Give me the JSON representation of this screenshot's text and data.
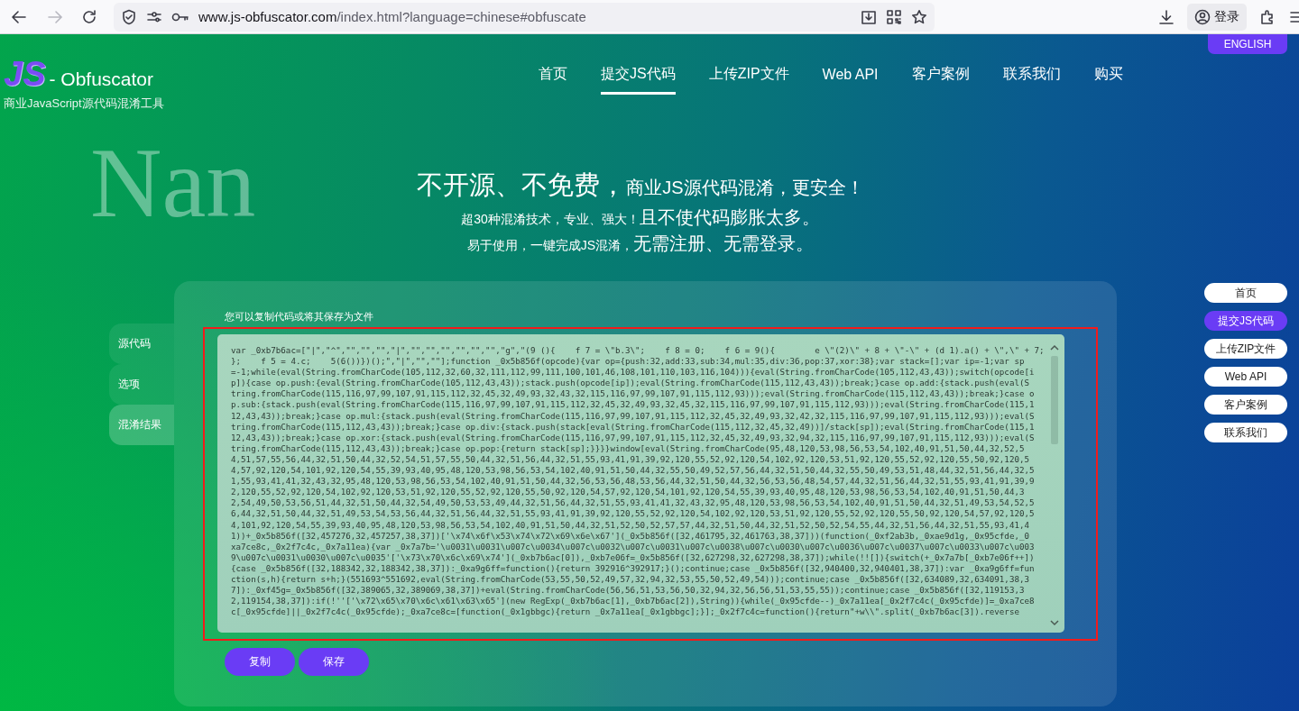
{
  "browser": {
    "forward_disabled": true,
    "url_host": "www.js-obfuscator.com",
    "url_path": "/index.html?language=chinese#obfuscate",
    "sign_in": "登录"
  },
  "header": {
    "logo_mark": "JS",
    "logo_name": "- Obfuscator",
    "tagline": "商业JavaScript源代码混淆工具",
    "language_button": "ENGLISH",
    "nav": [
      {
        "label": "首页",
        "selected": false
      },
      {
        "label": "提交JS代码",
        "selected": true
      },
      {
        "label": "上传ZIP文件",
        "selected": false
      },
      {
        "label": "Web API",
        "selected": false
      },
      {
        "label": "客户案例",
        "selected": false
      },
      {
        "label": "联系我们",
        "selected": false
      },
      {
        "label": "购买",
        "selected": false
      }
    ]
  },
  "backdrop_text": "Nan",
  "hero": [
    [
      {
        "text": "不开源、不免费，",
        "kind": "large"
      },
      {
        "text": "商业JS源代码混淆，更安全！",
        "kind": "medium"
      }
    ],
    [
      {
        "text": "超30种混淆技术，专业、强大！",
        "kind": "small"
      },
      {
        "text": "且不使代码膨胀太多。",
        "kind": "medium"
      }
    ],
    [
      {
        "text": "易于使用，一键完成JS混淆，",
        "kind": "small"
      },
      {
        "text": "无需注册、无需登录。",
        "kind": "medium"
      }
    ]
  ],
  "panel": {
    "tabs": [
      {
        "label": "源代码",
        "selected": false
      },
      {
        "label": "选项",
        "selected": false
      },
      {
        "label": "混淆结果",
        "selected": true
      }
    ],
    "hint": "您可以复制代码或将其保存为文件",
    "highlighted": true,
    "code_lines": [
      "var _0xb7b6ac=[\"|\",\"^\",\"\",\"\",\"\",\"|\",\"\",\"\",\"\",\"\",\"\",\"\",\"g\",\"(9 (){    f 7 = \\\"b.3\\\";    f 8 = 0;    f 6 = 9(){        e \\\"(2)\\\" + 8 + \\\"-\\\" + (d 1).a() + \\\",\\\" + 7;",
      "};    f 5 = 4.c;    5(6())})();\",\"|\",\"\",\"\"];function _0x5b856f(opcode){var op={push:32,add:33,sub:34,mul:35,div:36,pop:37,xor:38};var stack=[];var ip=-1;var sp",
      "=-1;while(eval(String.fromCharCode(105,112,32,60,32,111,112,99,111,100,101,46,108,101,110,103,116,104))){eval(String.fromCharCode(105,112,43,43));switch(opcode[i",
      "p]){case op.push:{eval(String.fromCharCode(105,112,43,43));stack.push(opcode[ip]);eval(String.fromCharCode(115,112,43,43));break;}case op.add:{stack.push(eval(S",
      "tring.fromCharCode(115,116,97,99,107,91,115,112,32,45,32,49,93,32,43,32,115,116,97,99,107,91,115,112,93)));eval(String.fromCharCode(115,112,43,43));break;}case o",
      "p.sub:{stack.push(eval(String.fromCharCode(115,116,97,99,107,91,115,112,32,45,32,49,93,32,45,32,115,116,97,99,107,91,115,112,93)));eval(String.fromCharCode(115,1",
      "12,43,43));break;}case op.mul:{stack.push(eval(String.fromCharCode(115,116,97,99,107,91,115,112,32,45,32,49,93,32,42,32,115,116,97,99,107,91,115,112,93)));eval(S",
      "tring.fromCharCode(115,112,43,43));break;}case op.div:{stack.push(stack[eval(String.fromCharCode(115,112,32,45,32,49))]/stack[sp]);eval(String.fromCharCode(115,1",
      "12,43,43));break;}case op.xor:{stack.push(eval(String.fromCharCode(115,116,97,99,107,91,115,112,32,45,32,49,93,32,94,32,115,116,97,99,107,91,115,112,93)));eval(S",
      "tring.fromCharCode(115,112,43,43));break;}case op.pop:{return stack[sp];}}}}window[eval(String.fromCharCode(95,48,120,53,98,56,53,54,102,40,91,51,50,44,32,52,5",
      "4,51,57,55,56,44,32,51,50,44,32,52,54,51,57,55,50,44,32,51,56,44,32,51,55,93,41,91,39,92,120,55,52,92,120,54,102,92,120,53,51,92,120,55,52,92,120,55,50,92,120,5",
      "4,57,92,120,54,101,92,120,54,55,39,93,40,95,48,120,53,98,56,53,54,102,40,91,51,50,44,32,55,50,49,52,57,56,44,32,51,50,44,32,55,50,49,53,51,48,44,32,51,56,44,32,5",
      "1,55,93,41,41,32,43,32,95,48,120,53,98,56,53,54,102,40,91,51,50,44,32,56,53,56,48,53,56,44,32,51,50,44,32,56,53,56,48,54,57,44,32,51,56,44,32,51,55,93,41,91,39,9",
      "2,120,55,52,92,120,54,102,92,120,53,51,92,120,55,52,92,120,55,50,92,120,54,57,92,120,54,101,92,120,54,55,39,93,40,95,48,120,53,98,56,53,54,102,40,91,51,50,44,3",
      "2,54,49,50,53,56,51,44,32,51,50,44,32,54,49,50,53,53,49,44,32,51,56,44,32,51,55,93,41,41,32,43,32,95,48,120,53,98,56,53,54,102,40,91,51,50,44,32,51,49,53,54,52,5",
      "6,44,32,51,50,44,32,51,49,53,54,53,56,44,32,51,56,44,32,51,55,93,41,91,39,92,120,55,52,92,120,54,102,92,120,53,51,92,120,55,52,92,120,55,50,92,120,54,57,92,120,5",
      "4,101,92,120,54,55,39,93,40,95,48,120,53,98,56,53,54,102,40,91,51,50,44,32,51,52,50,52,57,57,44,32,51,50,44,32,51,52,50,52,54,55,44,32,51,56,44,32,51,55,93,41,4",
      "1))+_0x5b856f([32,457276,32,457257,38,37])['\\x74\\x6f\\x53\\x74\\x72\\x69\\x6e\\x67'](_0x5b856f([32,461795,32,461763,38,37]))(function(_0xf2ab3b,_0xae9d1g,_0x95cfde,_0",
      "xa7ce8c,_0x2f7c4c,_0x7a11ea){var _0x7a7b='\\u0031\\u0031\\u007c\\u0034\\u007c\\u0032\\u007c\\u0031\\u007c\\u0038\\u007c\\u0030\\u007c\\u0036\\u007c\\u0037\\u007c\\u0033\\u007c\\u003",
      "9\\u007c\\u0031\\u0030\\u007c\\u0035'['\\x73\\x70\\x6c\\x69\\x74'](_0xb7b6ac[0]),_0xb7e06f=_0x5b856f([32,627298,32,627298,38,37]);while(!![]){switch(+_0x7a7b[_0xb7e06f++])",
      "{case _0x5b856f([32,188342,32,188342,38,37]):_0xa9g6ff=function(){return 392916^392917;}();continue;case _0x5b856f([32,940400,32,940401,38,37]):var _0xa9g6ff=fun",
      "ction(s,h){return s+h;}(551693^551692,eval(String.fromCharCode(53,55,50,52,49,57,32,94,32,53,55,50,52,49,54)));continue;case _0x5b856f([32,634089,32,634091,38,3",
      "7]):_0xf45g=_0x5b856f([32,389065,32,389069,38,37])+eval(String.fromCharCode(56,56,51,53,56,50,32,94,32,56,56,51,53,55,55));continue;case _0x5b856f([32,119153,3",
      "2,119154,38,37]):if(!''['\\x72\\x65\\x70\\x6c\\x61\\x63\\x65'](new RegExp(_0xb7b6ac[1],_0xb7b6ac[2]),String)){while(_0x95cfde--)_0x7a11ea[_0x2f7c4c(_0x95cfde)]=_0xa7ce8",
      "c[_0x95cfde]||_0x2f7c4c(_0x95cfde);_0xa7ce8c=[function(_0x1gbbgc){return _0x7a11ea[_0x1gbbgc];}];_0x2f7c4c=function(){return\"+w\\\\\".split(_0xb7b6ac[3]).reverse"
    ],
    "buttons": [
      "复制",
      "保存"
    ]
  },
  "side_nav": [
    {
      "label": "首页",
      "selected": false
    },
    {
      "label": "提交JS代码",
      "selected": true
    },
    {
      "label": "上传ZIP文件",
      "selected": false
    },
    {
      "label": "Web API",
      "selected": false
    },
    {
      "label": "客户案例",
      "selected": false
    },
    {
      "label": "联系我们",
      "selected": false
    }
  ]
}
